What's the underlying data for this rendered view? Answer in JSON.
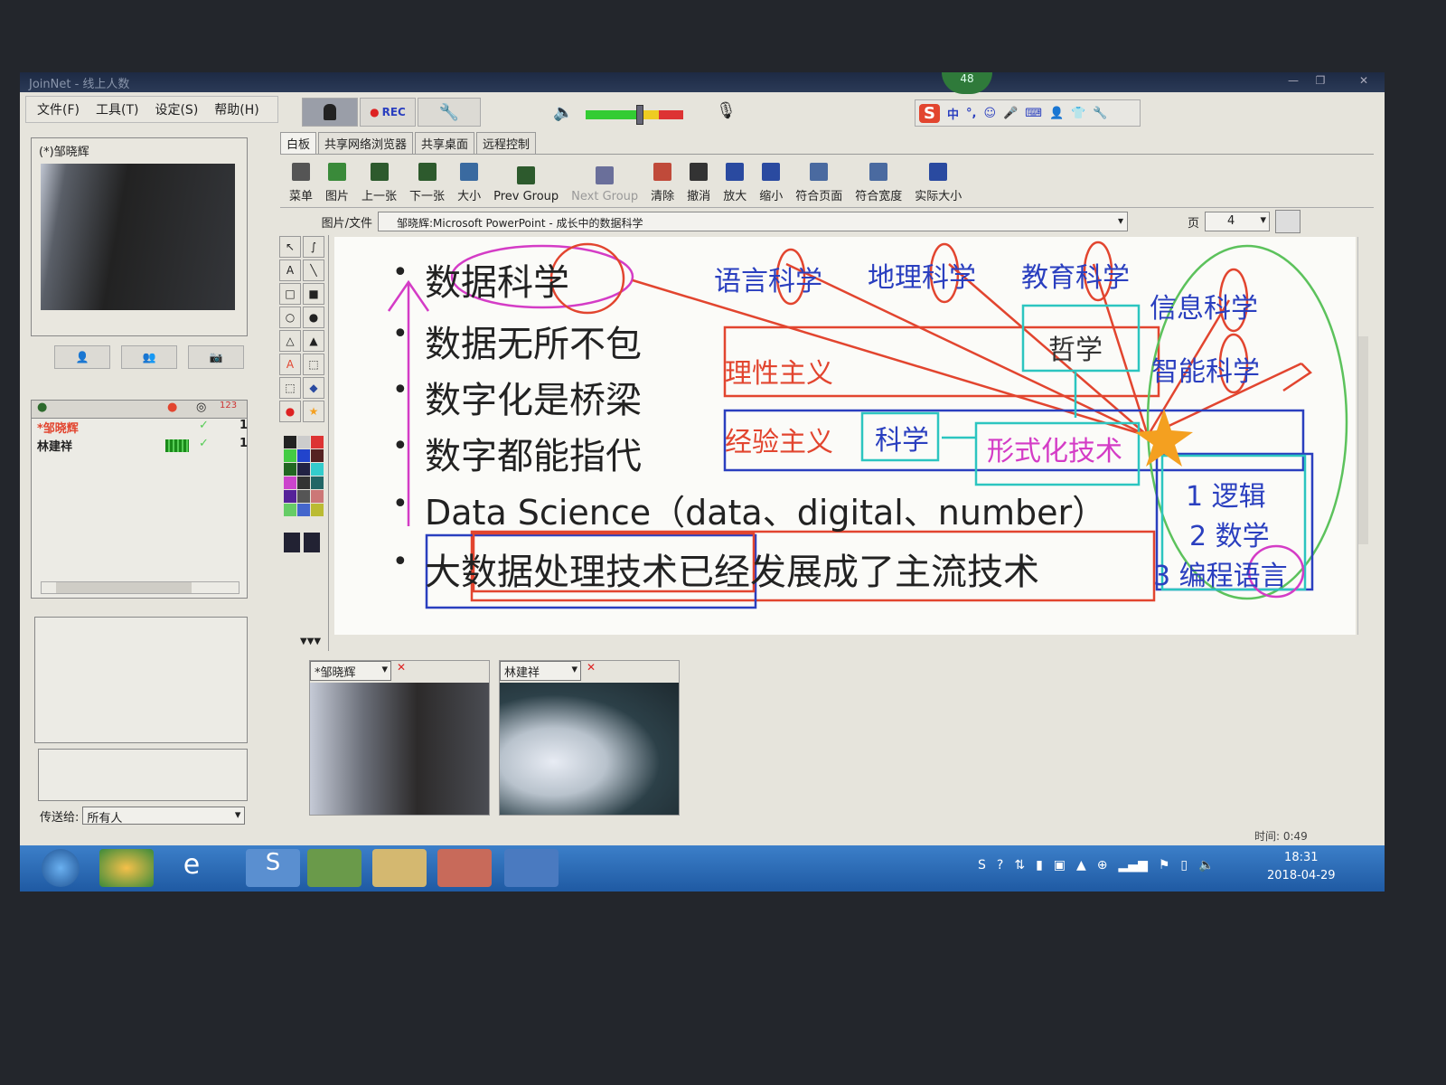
{
  "window": {
    "title": "JoinNet - 线上人数",
    "badge": "48",
    "minimize": "—",
    "restore": "❐",
    "close": "✕"
  },
  "menu": [
    "文件(F)",
    "工具(T)",
    "设定(S)",
    "帮助(H)"
  ],
  "top_buttons": {
    "rec": "REC"
  },
  "ime_bar": {
    "label": "中",
    "punct": "°,"
  },
  "tabs": [
    {
      "label": "白板",
      "active": true
    },
    {
      "label": "共享网络浏览器"
    },
    {
      "label": "共享桌面"
    },
    {
      "label": "远程控制"
    }
  ],
  "toolbar": [
    {
      "label": "菜单",
      "icon": "menu-icon",
      "color": "#555555"
    },
    {
      "label": "图片",
      "icon": "picture-icon",
      "color": "#3a8a3a"
    },
    {
      "label": "上一张",
      "icon": "previous-icon",
      "color": "#2d5a2d"
    },
    {
      "label": "下一张",
      "icon": "next-icon",
      "color": "#2d5a2d"
    },
    {
      "label": "大小",
      "icon": "size-icon",
      "color": "#3a6aa0"
    },
    {
      "label": "Prev Group",
      "icon": "prev-group-icon",
      "color": "#2d5a2d"
    },
    {
      "label": "Next Group",
      "icon": "next-group-icon",
      "color": "#6a6f9a",
      "disabled": true
    },
    {
      "label": "清除",
      "icon": "clear-icon",
      "color": "#c04a3a"
    },
    {
      "label": "撤消",
      "icon": "undo-icon",
      "color": "#333333"
    },
    {
      "label": "放大",
      "icon": "zoom-in-icon",
      "color": "#2a4aa0"
    },
    {
      "label": "缩小",
      "icon": "zoom-out-icon",
      "color": "#2a4aa0"
    },
    {
      "label": "符合页面",
      "icon": "fit-page-icon",
      "color": "#4a6aa0"
    },
    {
      "label": "符合宽度",
      "icon": "fit-width-icon",
      "color": "#4a6aa0"
    },
    {
      "label": "实际大小",
      "icon": "actual-size-icon",
      "color": "#2a4aa0"
    }
  ],
  "file_row": {
    "label": "图片/文件",
    "value": "邹晓辉:Microsoft PowerPoint - 成长中的数据科学",
    "page_label": "页",
    "page_value": "4"
  },
  "left_panel": {
    "video_title": "(*)邹晓辉",
    "participants": [
      {
        "name": "*邹晓辉",
        "color": "#e2452f",
        "check": "✓",
        "count": "1"
      },
      {
        "name": "林建祥",
        "color": "#222222",
        "check": "✓",
        "count": "1",
        "speaking": true
      }
    ],
    "send_to_label": "传送给:",
    "send_to_value": "所有人"
  },
  "slide": {
    "bullets": [
      "数据科学",
      "数据无所不包",
      "数字化是桥梁",
      "数字都能指代",
      "Data Science（data、digital、number）",
      "大数据处理技术已经发展成了主流技术"
    ],
    "annotations": {
      "top_labels": [
        "语言科学",
        "地理科学",
        "教育科学"
      ],
      "right_labels": [
        "信息科学",
        "智能科学"
      ],
      "rationalism": "理性主义",
      "philosophy": "哲学",
      "empiricism": "经验主义",
      "science": "科学",
      "formal_tech": "形式化技术",
      "list": [
        "1 逻辑",
        "2 数学",
        "3 编程语言"
      ]
    },
    "colors": {
      "red": "#e2452f",
      "blue": "#2a3fbf",
      "cyan": "#2cc5c0",
      "pink": "#d43cc6",
      "green": "#5cc25c",
      "orange": "#f4a020"
    }
  },
  "videos": [
    {
      "name": "*邹晓辉"
    },
    {
      "name": "林建祥"
    }
  ],
  "status": {
    "time": "时间: 0:49"
  },
  "taskbar": {
    "clock": "18:31",
    "date": "2018-04-29"
  }
}
